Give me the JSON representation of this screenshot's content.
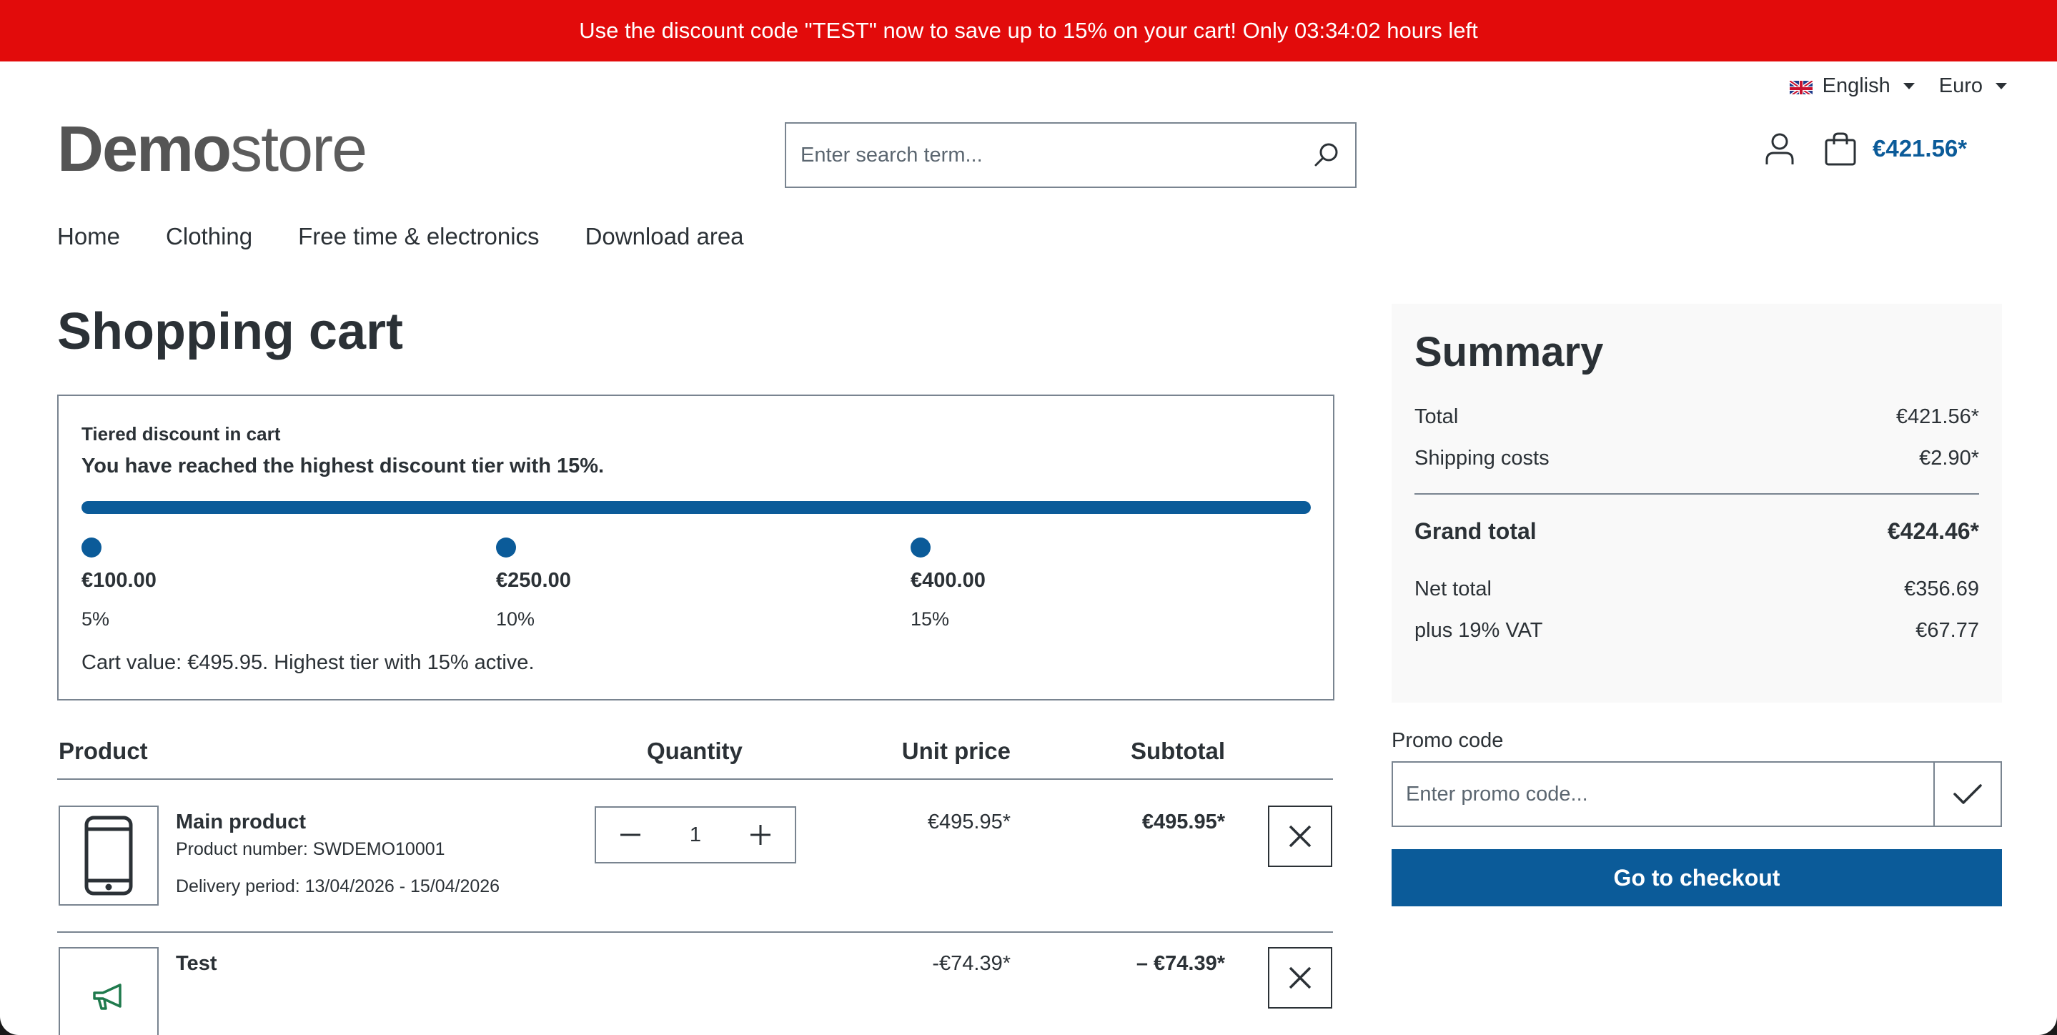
{
  "topbar": {
    "text": "Use the discount code \"TEST\" now to save up to 15% on your cart! Only 03:34:02 hours left"
  },
  "locale": {
    "language": "English",
    "currency": "Euro"
  },
  "logo": {
    "bold": "Demo",
    "light": "store"
  },
  "search": {
    "placeholder": "Enter search term..."
  },
  "header": {
    "cart_total": "€421.56*"
  },
  "nav": [
    "Home",
    "Clothing",
    "Free time & electronics",
    "Download area"
  ],
  "page": {
    "title": "Shopping cart"
  },
  "tier_discount": {
    "label": "Tiered discount in cart",
    "message": "You have reached the highest discount tier with 15%.",
    "progress": 1.0,
    "tiers": [
      {
        "threshold": "€100.00",
        "percent": "5%"
      },
      {
        "threshold": "€250.00",
        "percent": "10%"
      },
      {
        "threshold": "€400.00",
        "percent": "15%"
      }
    ],
    "note": "Cart value: €495.95. Highest tier with 15% active."
  },
  "table": {
    "headers": {
      "product": "Product",
      "quantity": "Quantity",
      "unit_price": "Unit price",
      "subtotal": "Subtotal"
    }
  },
  "items": [
    {
      "name": "Main product",
      "number": "Product number: SWDEMO10001",
      "delivery": "Delivery period: 13/04/2026 - 15/04/2026",
      "quantity": "1",
      "unit_price": "€495.95*",
      "subtotal": "€495.95*",
      "icon": "smartphone-icon"
    },
    {
      "name": "Test",
      "unit_price": "-€74.39*",
      "subtotal": "– €74.39*",
      "icon": "megaphone-icon"
    }
  ],
  "summary": {
    "title": "Summary",
    "total_label": "Total",
    "total": "€421.56*",
    "shipping_label": "Shipping costs",
    "shipping": "€2.90*",
    "grand_label": "Grand total",
    "grand": "€424.46*",
    "net_label": "Net total",
    "net": "€356.69",
    "vat_label": "plus 19% VAT",
    "vat": "€67.77"
  },
  "promo": {
    "label": "Promo code",
    "placeholder": "Enter promo code..."
  },
  "checkout": {
    "label": "Go to checkout"
  },
  "colors": {
    "accent": "#0b5b99",
    "banner": "#e20b0b",
    "megaphone": "#1f7a4d"
  }
}
